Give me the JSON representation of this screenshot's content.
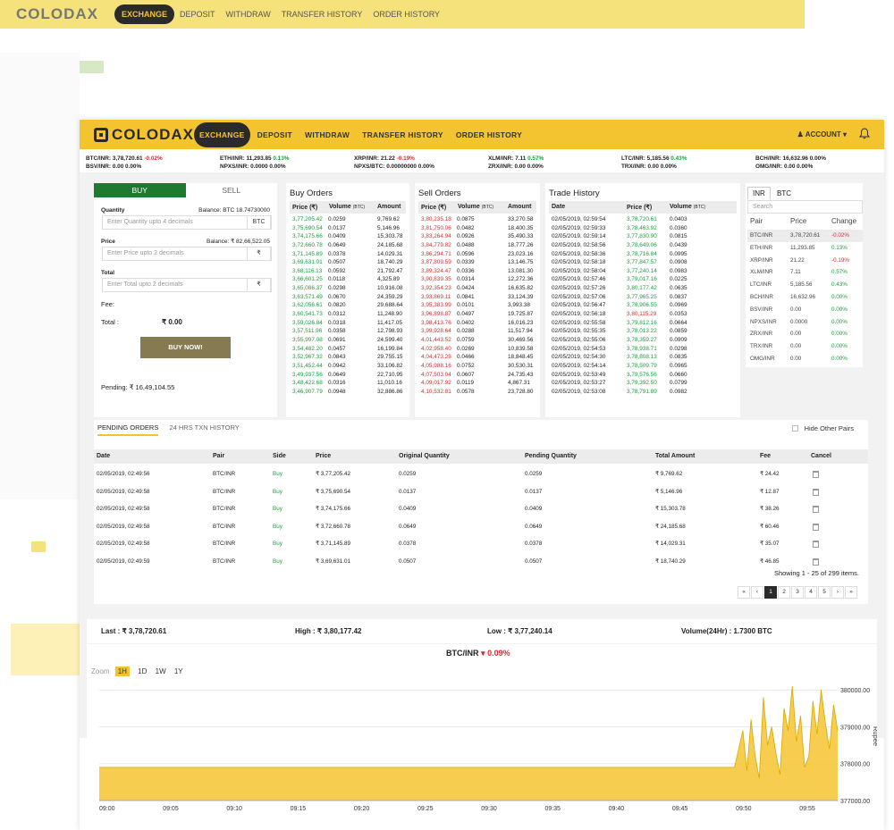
{
  "brand": "COLODAX",
  "nav": {
    "items": [
      "EXCHANGE",
      "DEPOSIT",
      "WITHDRAW",
      "TRANSFER HISTORY",
      "ORDER HISTORY"
    ],
    "account": "ACCOUNT"
  },
  "ticker": [
    {
      "pair": "BTC/INR:",
      "price": "3,78,720.61",
      "change": "-0.02%",
      "dir": "neg"
    },
    {
      "pair": "BSV/INR:",
      "price": "0.00",
      "change": "0.00%",
      "dir": "zero"
    },
    {
      "pair": "ETH/INR:",
      "price": "11,293.85",
      "change": "0.13%",
      "dir": "pos"
    },
    {
      "pair": "NPXS/INR:",
      "price": "0.0000",
      "change": "0.00%",
      "dir": "zero"
    },
    {
      "pair": "XRP/INR:",
      "price": "21.22",
      "change": "-0.19%",
      "dir": "neg"
    },
    {
      "pair": "NPXS/BTC:",
      "price": "0.00000000",
      "change": "0.00%",
      "dir": "zero"
    },
    {
      "pair": "XLM/INR:",
      "price": "7.11",
      "change": "0.57%",
      "dir": "pos"
    },
    {
      "pair": "ZRX/INR:",
      "price": "0.00",
      "change": "0.00%",
      "dir": "zero"
    },
    {
      "pair": "LTC/INR:",
      "price": "5,185.56",
      "change": "0.43%",
      "dir": "pos"
    },
    {
      "pair": "TRX/INR:",
      "price": "0.00",
      "change": "0.00%",
      "dir": "zero"
    },
    {
      "pair": "BCH/INR:",
      "price": "16,632.96",
      "change": "0.00%",
      "dir": "zero"
    },
    {
      "pair": "OMG/INR:",
      "price": "0.00",
      "change": "0.00%",
      "dir": "zero"
    }
  ],
  "trade_form": {
    "buy_tab": "BUY",
    "sell_tab": "SELL",
    "quantity_label": "Quantity",
    "quantity_balance": "Balance: BTC 18.74730000",
    "quantity_placeholder": "Enter Quantity upto 4 decimals",
    "quantity_unit": "BTC",
    "price_label": "Price",
    "price_balance": "Balance: ₹ 82,66,522.05",
    "price_placeholder": "Enter Price upto 2 decimals",
    "price_unit": "₹",
    "total_label": "Total",
    "total_placeholder": "Enter Total upto 2 decimals",
    "total_unit": "₹",
    "fee_label": "Fee:",
    "total_line_label": "Total :",
    "total_value": "₹ 0.00",
    "buy_button": "BUY NOW!",
    "pending_text": "Pending: ₹ 16,49,104.55"
  },
  "buy_orders": {
    "title": "Buy Orders",
    "headers": [
      "Price (₹)",
      "Volume",
      "(BTC)",
      "Amount"
    ],
    "rows": [
      [
        "3,77,205.42",
        "0.0259",
        "9,769.62"
      ],
      [
        "3,75,690.54",
        "0.0137",
        "5,146.96"
      ],
      [
        "3,74,175.66",
        "0.0409",
        "15,303.78"
      ],
      [
        "3,72,660.78",
        "0.0649",
        "24,185.68"
      ],
      [
        "3,71,145.89",
        "0.0378",
        "14,029.31"
      ],
      [
        "3,69,631.01",
        "0.0507",
        "18,740.29"
      ],
      [
        "3,68,116.13",
        "0.0592",
        "21,792.47"
      ],
      [
        "3,66,601.25",
        "0.0118",
        "4,325.89"
      ],
      [
        "3,65,086.37",
        "0.0298",
        "10,916.08"
      ],
      [
        "3,63,571.49",
        "0.0670",
        "24,359.29"
      ],
      [
        "3,62,056.61",
        "0.0820",
        "29,688.64"
      ],
      [
        "3,60,541.73",
        "0.0312",
        "11,248.90"
      ],
      [
        "3,59,026.84",
        "0.0318",
        "11,417.05"
      ],
      [
        "3,57,511.96",
        "0.0358",
        "12,798.93"
      ],
      [
        "3,55,997.08",
        "0.0691",
        "24,599.40"
      ],
      [
        "3,54,482.20",
        "0.0457",
        "16,199.84"
      ],
      [
        "3,52,967.32",
        "0.0843",
        "29,755.15"
      ],
      [
        "3,51,452.44",
        "0.0942",
        "33,106.82"
      ],
      [
        "3,49,937.56",
        "0.0649",
        "22,710.95"
      ],
      [
        "3,48,422.68",
        "0.0316",
        "11,010.16"
      ],
      [
        "3,46,907.79",
        "0.0948",
        "32,886.86"
      ]
    ]
  },
  "sell_orders": {
    "title": "Sell Orders",
    "headers": [
      "Price (₹)",
      "Volume",
      "(BTC)",
      "Amount"
    ],
    "rows": [
      [
        "3,80,235.18",
        "0.0875",
        "33,270.58"
      ],
      [
        "3,81,750.06",
        "0.0482",
        "18,400.35"
      ],
      [
        "3,83,264.94",
        "0.0926",
        "35,490.33"
      ],
      [
        "3,84,779.82",
        "0.0488",
        "18,777.26"
      ],
      [
        "3,86,294.71",
        "0.0596",
        "23,023.16"
      ],
      [
        "3,87,809.59",
        "0.0339",
        "13,146.75"
      ],
      [
        "3,89,324.47",
        "0.0336",
        "13,081.30"
      ],
      [
        "3,90,839.35",
        "0.0314",
        "12,272.36"
      ],
      [
        "3,92,354.23",
        "0.0424",
        "16,635.82"
      ],
      [
        "3,93,869.11",
        "0.0841",
        "33,124.39"
      ],
      [
        "3,95,383.99",
        "0.0101",
        "3,993.38"
      ],
      [
        "3,96,898.87",
        "0.0497",
        "19,725.87"
      ],
      [
        "3,98,413.76",
        "0.0402",
        "16,016.23"
      ],
      [
        "3,99,928.64",
        "0.0288",
        "11,517.94"
      ],
      [
        "4,01,443.52",
        "0.0759",
        "30,469.56"
      ],
      [
        "4,02,958.40",
        "0.0269",
        "10,839.58"
      ],
      [
        "4,04,473.28",
        "0.0466",
        "18,848.45"
      ],
      [
        "4,05,988.16",
        "0.0752",
        "30,530.31"
      ],
      [
        "4,07,503.04",
        "0.0607",
        "24,735.43"
      ],
      [
        "4,09,017.92",
        "0.0119",
        "4,867.31"
      ],
      [
        "4,10,532.81",
        "0.0578",
        "23,728.80"
      ]
    ]
  },
  "trade_history": {
    "title": "Trade History",
    "headers": [
      "Date",
      "Price (₹)",
      "Volume",
      "(BTC)"
    ],
    "rows": [
      [
        "02/05/2019, 02:59:54",
        "3,78,720.61",
        "0.0403",
        "g"
      ],
      [
        "02/05/2019, 02:59:33",
        "3,78,463.92",
        "0.0360",
        "g"
      ],
      [
        "02/05/2019, 02:59:14",
        "3,77,830.90",
        "0.0815",
        "g"
      ],
      [
        "02/05/2019, 02:58:56",
        "3,78,649.06",
        "0.0439",
        "g"
      ],
      [
        "02/05/2019, 02:58:36",
        "3,78,716.84",
        "0.0995",
        "g"
      ],
      [
        "02/05/2019, 02:58:18",
        "3,77,847.57",
        "0.0908",
        "g"
      ],
      [
        "02/05/2019, 02:58:04",
        "3,77,240.14",
        "0.0983",
        "g"
      ],
      [
        "02/05/2019, 02:57:46",
        "3,79,017.16",
        "0.0225",
        "g"
      ],
      [
        "02/05/2019, 02:57:26",
        "3,80,177.42",
        "0.0635",
        "g"
      ],
      [
        "02/05/2019, 02:57:06",
        "3,77,965.25",
        "0.0837",
        "g"
      ],
      [
        "02/05/2019, 02:56:47",
        "3,78,906.55",
        "0.0969",
        "g"
      ],
      [
        "02/05/2019, 02:56:18",
        "3,80,115.29",
        "0.0353",
        "r"
      ],
      [
        "02/05/2019, 02:55:58",
        "3,79,812.16",
        "0.0664",
        "g"
      ],
      [
        "02/05/2019, 02:55:35",
        "3,78,013.22",
        "0.0859",
        "g"
      ],
      [
        "02/05/2019, 02:55:06",
        "3,78,359.27",
        "0.0909",
        "g"
      ],
      [
        "02/05/2019, 02:54:53",
        "3,78,938.71",
        "0.0298",
        "g"
      ],
      [
        "02/05/2019, 02:54:30",
        "3,78,808.13",
        "0.0835",
        "g"
      ],
      [
        "02/05/2019, 02:54:14",
        "3,78,509.79",
        "0.0965",
        "g"
      ],
      [
        "02/05/2019, 02:53:49",
        "3,79,576.56",
        "0.0660",
        "g"
      ],
      [
        "02/05/2019, 02:53:27",
        "3,79,392.50",
        "0.0799",
        "g"
      ],
      [
        "02/05/2019, 02:53:08",
        "3,78,791.89",
        "0.0982",
        "g"
      ]
    ]
  },
  "market": {
    "tabs": [
      "INR",
      "BTC"
    ],
    "search_placeholder": "Search",
    "headers": [
      "Pair",
      "Price",
      "Change"
    ],
    "rows": [
      [
        "BTC/INR",
        "3,78,720.61",
        "-0.02%",
        "neg"
      ],
      [
        "ETH/INR",
        "11,293.85",
        "0.13%",
        "pos"
      ],
      [
        "XRP/INR",
        "21.22",
        "-0.19%",
        "neg"
      ],
      [
        "XLM/INR",
        "7.11",
        "0.57%",
        "pos"
      ],
      [
        "LTC/INR",
        "5,185.56",
        "0.43%",
        "pos"
      ],
      [
        "BCH/INR",
        "16,632.96",
        "0.00%",
        "pos"
      ],
      [
        "BSV/INR",
        "0.00",
        "0.00%",
        "pos"
      ],
      [
        "NPXS/INR",
        "0.0000",
        "0.00%",
        "pos"
      ],
      [
        "ZRX/INR",
        "0.00",
        "0.00%",
        "pos"
      ],
      [
        "TRX/INR",
        "0.00",
        "0.00%",
        "pos"
      ],
      [
        "OMG/INR",
        "0.00",
        "0.00%",
        "pos"
      ]
    ]
  },
  "pending": {
    "tabs": [
      "PENDING ORDERS",
      "24 HRS TXN HISTORY"
    ],
    "hide_other_pairs": "Hide Other Pairs",
    "headers": [
      "Date",
      "Pair",
      "Side",
      "Price",
      "Original Quantity",
      "Pending Quantity",
      "Total Amount",
      "Fee",
      "Cancel"
    ],
    "rows": [
      [
        "02/05/2019, 02:49:56",
        "BTC/INR",
        "Buy",
        "₹ 3,77,205.42",
        "0.0259",
        "0.0259",
        "₹ 9,769.62",
        "₹ 24.42"
      ],
      [
        "02/05/2019, 02:49:58",
        "BTC/INR",
        "Buy",
        "₹ 3,75,690.54",
        "0.0137",
        "0.0137",
        "₹ 5,146.96",
        "₹ 12.87"
      ],
      [
        "02/05/2019, 02:49:58",
        "BTC/INR",
        "Buy",
        "₹ 3,74,175.66",
        "0.0409",
        "0.0409",
        "₹ 15,303.78",
        "₹ 38.26"
      ],
      [
        "02/05/2019, 02:49:58",
        "BTC/INR",
        "Buy",
        "₹ 3,72,660.78",
        "0.0649",
        "0.0649",
        "₹ 24,185.68",
        "₹ 60.46"
      ],
      [
        "02/05/2019, 02:49:58",
        "BTC/INR",
        "Buy",
        "₹ 3,71,145.89",
        "0.0378",
        "0.0378",
        "₹ 14,029.31",
        "₹ 35.07"
      ],
      [
        "02/05/2019, 02:49:59",
        "BTC/INR",
        "Buy",
        "₹ 3,69,631.01",
        "0.0507",
        "0.0507",
        "₹ 18,740.29",
        "₹ 46.85"
      ]
    ],
    "showing": "Showing 1 - 25 of 299 items.",
    "pages": [
      "«",
      "‹",
      "1",
      "2",
      "3",
      "4",
      "5",
      "›",
      "»"
    ],
    "current_page": "1"
  },
  "stats": {
    "last_label": "Last :",
    "last_value": "₹ 3,78,720.61",
    "high_label": "High :",
    "high_value": "₹ 3,80,177.42",
    "low_label": "Low :",
    "low_value": "₹ 3,77,240.14",
    "volume_label": "Volume(24Hr) :",
    "volume_value": "1.7300 BTC"
  },
  "chart": {
    "pair": "BTC/INR",
    "change": "0.09%",
    "zoom_label": "Zoom",
    "zoom_options": [
      "1H",
      "1D",
      "1W",
      "1Y"
    ],
    "zoom_selected": "1H"
  },
  "chart_data": {
    "type": "area",
    "title": "BTC/INR",
    "ylabel": "Rupee",
    "x_ticks": [
      "09:00",
      "09:05",
      "09:10",
      "09:15",
      "09:20",
      "09:25",
      "09:30",
      "09:35",
      "09:40",
      "09:45",
      "09:50",
      "09:55"
    ],
    "y_ticks": [
      "377000.00",
      "378000.00",
      "379000.00",
      "380000.00"
    ],
    "ylim": [
      377000,
      380150
    ],
    "color": "#f4c430",
    "series": [
      {
        "x": [
          0,
          1,
          2,
          3,
          4,
          5,
          6,
          7,
          8,
          9,
          10,
          11,
          12,
          13,
          14,
          15,
          16,
          17,
          18,
          19,
          20,
          21,
          22,
          23,
          24,
          25,
          26,
          27,
          28,
          29,
          30,
          31,
          32,
          33,
          34,
          35,
          36,
          37,
          38,
          39,
          40,
          41,
          42,
          43,
          44,
          45,
          46,
          47,
          48,
          49,
          50,
          51,
          52,
          53,
          54,
          55,
          56,
          57,
          58,
          59,
          60,
          61,
          62,
          63,
          64,
          65,
          66,
          67,
          68,
          69,
          70,
          71,
          72,
          73,
          74,
          75,
          76,
          77,
          78,
          79,
          80,
          81,
          82,
          83,
          84,
          85,
          86,
          87,
          88,
          89,
          90,
          91,
          92,
          93,
          94,
          95,
          96,
          97,
          98,
          99,
          100,
          101,
          102,
          103,
          104,
          105,
          106,
          107,
          108,
          109,
          110,
          111,
          112,
          113,
          114,
          115,
          116,
          117,
          118,
          119,
          120,
          121,
          122,
          123,
          124,
          125,
          126,
          127,
          128,
          129,
          130,
          131,
          132,
          133,
          134,
          135,
          136,
          137,
          138,
          139,
          140,
          141,
          142,
          143,
          144,
          145,
          146,
          147,
          148,
          149,
          150,
          151,
          152,
          153,
          154,
          155,
          156,
          157,
          158,
          159,
          160,
          161,
          162,
          163,
          164,
          165,
          166,
          167,
          168,
          169,
          170,
          171,
          172,
          173,
          174,
          175,
          176,
          177,
          178,
          179
        ],
        "values": [
          377900,
          377900,
          377900,
          377900,
          377900,
          377900,
          377900,
          377900,
          377900,
          377900,
          377900,
          377900,
          377900,
          377900,
          377900,
          377900,
          377900,
          377900,
          377900,
          377900,
          377900,
          377900,
          377900,
          377900,
          377900,
          377900,
          377900,
          377900,
          377900,
          377900,
          377900,
          377900,
          377900,
          377900,
          377900,
          377900,
          377900,
          377900,
          377900,
          377900,
          377900,
          377900,
          377900,
          377900,
          377900,
          377900,
          377900,
          377900,
          377900,
          377900,
          377900,
          377900,
          377900,
          377900,
          377900,
          377900,
          377900,
          377900,
          377900,
          377900,
          377900,
          377900,
          377900,
          377900,
          377900,
          377900,
          377900,
          377900,
          377900,
          377900,
          377900,
          377900,
          377900,
          377900,
          377900,
          377900,
          377900,
          377900,
          377900,
          377900,
          377900,
          377900,
          377900,
          377900,
          377900,
          377900,
          377900,
          377900,
          377900,
          377900,
          377900,
          377900,
          377900,
          377900,
          377900,
          377900,
          377900,
          377900,
          377900,
          377900,
          377900,
          377900,
          377900,
          377900,
          377900,
          377900,
          377900,
          377900,
          377900,
          377900,
          377900,
          377900,
          377900,
          377900,
          377900,
          377900,
          377900,
          377900,
          377900,
          377900,
          377900,
          377900,
          377900,
          377900,
          377900,
          377900,
          377900,
          377900,
          377900,
          377900,
          377900,
          377900,
          377900,
          377900,
          377900,
          377900,
          377900,
          377900,
          377900,
          377900,
          377900,
          377900,
          377900,
          377900,
          377900,
          377900,
          377900,
          377900,
          377900,
          377900,
          377900,
          377900,
          377900,
          377900,
          377900,
          378400,
          378900,
          377800,
          379200,
          378200,
          377600,
          379800,
          378500,
          379000,
          378300,
          377700,
          379500,
          378900,
          380100,
          378600,
          379300,
          377900,
          378200,
          379700,
          378800,
          380000,
          379100,
          378400,
          379600,
          378900
        ]
      }
    ]
  }
}
